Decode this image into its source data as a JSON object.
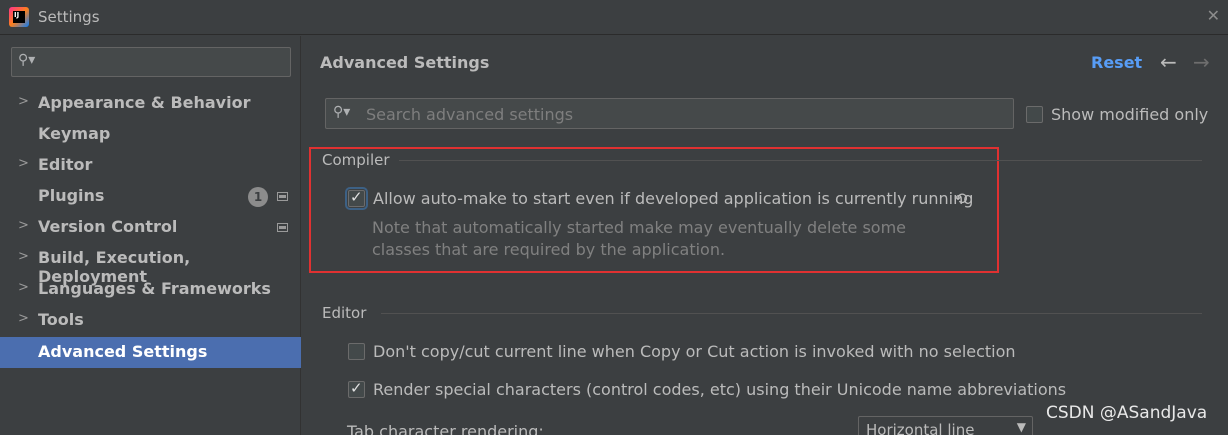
{
  "window": {
    "title": "Settings"
  },
  "sidebar": {
    "search_placeholder": "",
    "items": [
      {
        "label": "Appearance & Behavior",
        "expandable": true
      },
      {
        "label": "Keymap",
        "expandable": false
      },
      {
        "label": "Editor",
        "expandable": true
      },
      {
        "label": "Plugins",
        "expandable": false,
        "badge": "1"
      },
      {
        "label": "Version Control",
        "expandable": true
      },
      {
        "label": "Build, Execution, Deployment",
        "expandable": true
      },
      {
        "label": "Languages & Frameworks",
        "expandable": true
      },
      {
        "label": "Tools",
        "expandable": true
      },
      {
        "label": "Advanced Settings",
        "expandable": false,
        "selected": true
      }
    ]
  },
  "main": {
    "title": "Advanced Settings",
    "reset_label": "Reset",
    "search_placeholder": "Search advanced settings",
    "show_modified_label": "Show modified only",
    "sections": {
      "compiler": {
        "title": "Compiler",
        "option_label": "Allow auto-make to start even if developed application is currently running",
        "option_checked": true,
        "note_line1": "Note that automatically started make may eventually delete some",
        "note_line2": "classes that are required by the application."
      },
      "editor": {
        "title": "Editor",
        "option1_label": "Don't copy/cut current line when Copy or Cut action is invoked with no selection",
        "option1_checked": false,
        "option2_label": "Render special characters (control codes, etc) using their Unicode name abbreviations",
        "option2_checked": true,
        "tab_rendering_label": "Tab character rendering:",
        "tab_rendering_value": "Horizontal line"
      }
    }
  },
  "watermark": "CSDN @ASandJava",
  "colors": {
    "accent": "#4b6eaf",
    "link": "#589df6",
    "highlight_box": "#e03131",
    "background": "#3c3f41"
  }
}
